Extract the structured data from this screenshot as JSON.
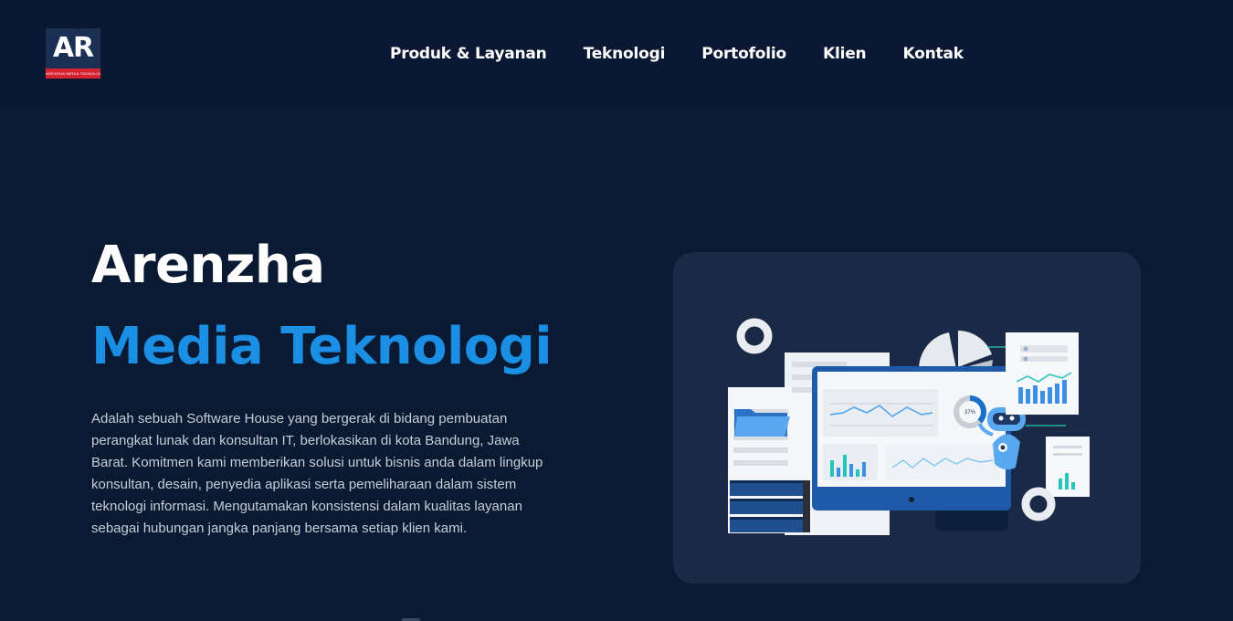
{
  "brand": {
    "logo_text": "AR",
    "logo_tagline": "ARENZHA MEDIA TEKNOLOGI"
  },
  "nav": {
    "items": [
      "Produk & Layanan",
      "Teknologi",
      "Portofolio",
      "Klien",
      "Kontak"
    ]
  },
  "hero": {
    "title_line1": "Arenzha",
    "title_line2": "Media Teknologi",
    "description": "Adalah sebuah Software House yang bergerak di bidang pembuatan perangkat lunak dan konsultan IT, berlokasikan di kota Bandung, Jawa Barat. Komitmen kami memberikan solusi untuk bisnis anda dalam lingkup konsultan, desain, penyedia aplikasi serta pemeliharaan dalam sistem teknologi informasi. Mengutamakan konsistensi dalam kualitas layanan sebagai hubungan jangka panjang bersama setiap klien kami."
  },
  "illustration": {
    "donut_label": "37%"
  },
  "colors": {
    "background": "#0b1a33",
    "navbar": "#0a1833",
    "accent": "#1a8fe3",
    "card": "#1a2a46",
    "logo_red": "#d62231"
  }
}
